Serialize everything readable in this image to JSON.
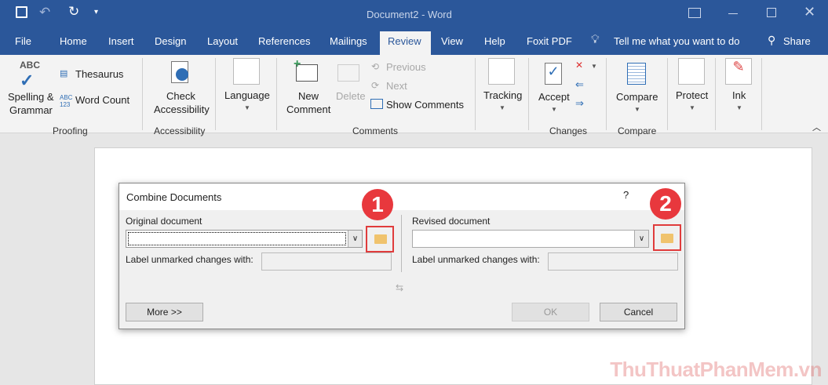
{
  "window": {
    "title": "Document2  -  Word"
  },
  "tabs": [
    "File",
    "Home",
    "Insert",
    "Design",
    "Layout",
    "References",
    "Mailings",
    "Review",
    "View",
    "Help",
    "Foxit PDF"
  ],
  "tell_me": "Tell me what you want to do",
  "share": "Share",
  "ribbon": {
    "spelling": "Spelling &",
    "grammar": "Grammar",
    "thesaurus": "Thesaurus",
    "word_count": "Word Count",
    "proofing": "Proofing",
    "check": "Check",
    "accessibility_btn": "Accessibility",
    "accessibility_grp": "Accessibility",
    "language": "Language",
    "new": "New",
    "comment": "Comment",
    "delete": "Delete",
    "previous": "Previous",
    "next": "Next",
    "show_comments": "Show Comments",
    "comments_grp": "Comments",
    "tracking": "Tracking",
    "accept": "Accept",
    "changes_grp": "Changes",
    "compare": "Compare",
    "compare_grp": "Compare",
    "protect": "Protect",
    "ink": "Ink"
  },
  "dialog": {
    "title": "Combine Documents",
    "help": "?",
    "original_label": "Original document",
    "original_value": "",
    "label_unmarked": "Label unmarked changes with:",
    "original_label_value": "",
    "revised_label": "Revised document",
    "revised_value": "",
    "revised_label_value": "",
    "more": "More >>",
    "ok": "OK",
    "cancel": "Cancel",
    "badge1": "1",
    "badge2": "2"
  },
  "watermark": "ThuThuatPhanMem.vn"
}
